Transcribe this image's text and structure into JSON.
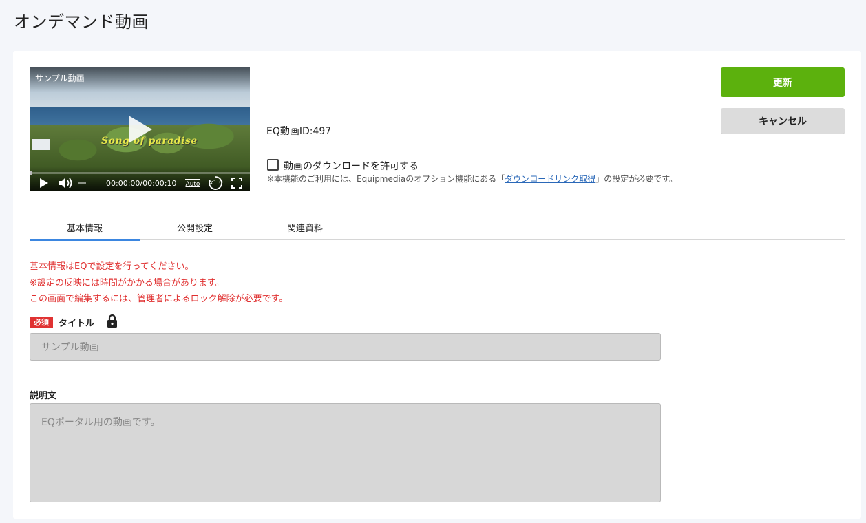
{
  "page": {
    "title": "オンデマンド動画"
  },
  "video": {
    "title": "サンプル動画",
    "overlay_text": "Song of paradise",
    "time": "00:00:00/00:00:10",
    "quality": "Auto",
    "speed": "x1.0"
  },
  "info": {
    "eq_id": "EQ動画ID:497",
    "download_label": "動画のダウンロードを許可する",
    "download_checked": false,
    "note_prefix": "※本機能のご利用には、Equipmediaのオプション機能にある「",
    "note_link": "ダウンロードリンク取得",
    "note_suffix": "」の設定が必要です。"
  },
  "buttons": {
    "update": "更新",
    "cancel": "キャンセル"
  },
  "tabs": [
    {
      "label": "基本情報",
      "active": true
    },
    {
      "label": "公開設定",
      "active": false
    },
    {
      "label": "関連資料",
      "active": false
    }
  ],
  "warnings": [
    "基本情報はEQで設定を行ってください。",
    "※設定の反映には時間がかかる場合があります。",
    "この画面で編集するには、管理者によるロック解除が必要です。"
  ],
  "form": {
    "required_badge": "必須",
    "title_label": "タイトル",
    "title_value": "サンプル動画",
    "description_label": "説明文",
    "description_value": "EQポータル用の動画です。"
  },
  "colors": {
    "accent_green": "#5cb10d",
    "tab_active": "#3b86e0",
    "warning_red": "#e03030",
    "link_blue": "#2a68b8"
  }
}
